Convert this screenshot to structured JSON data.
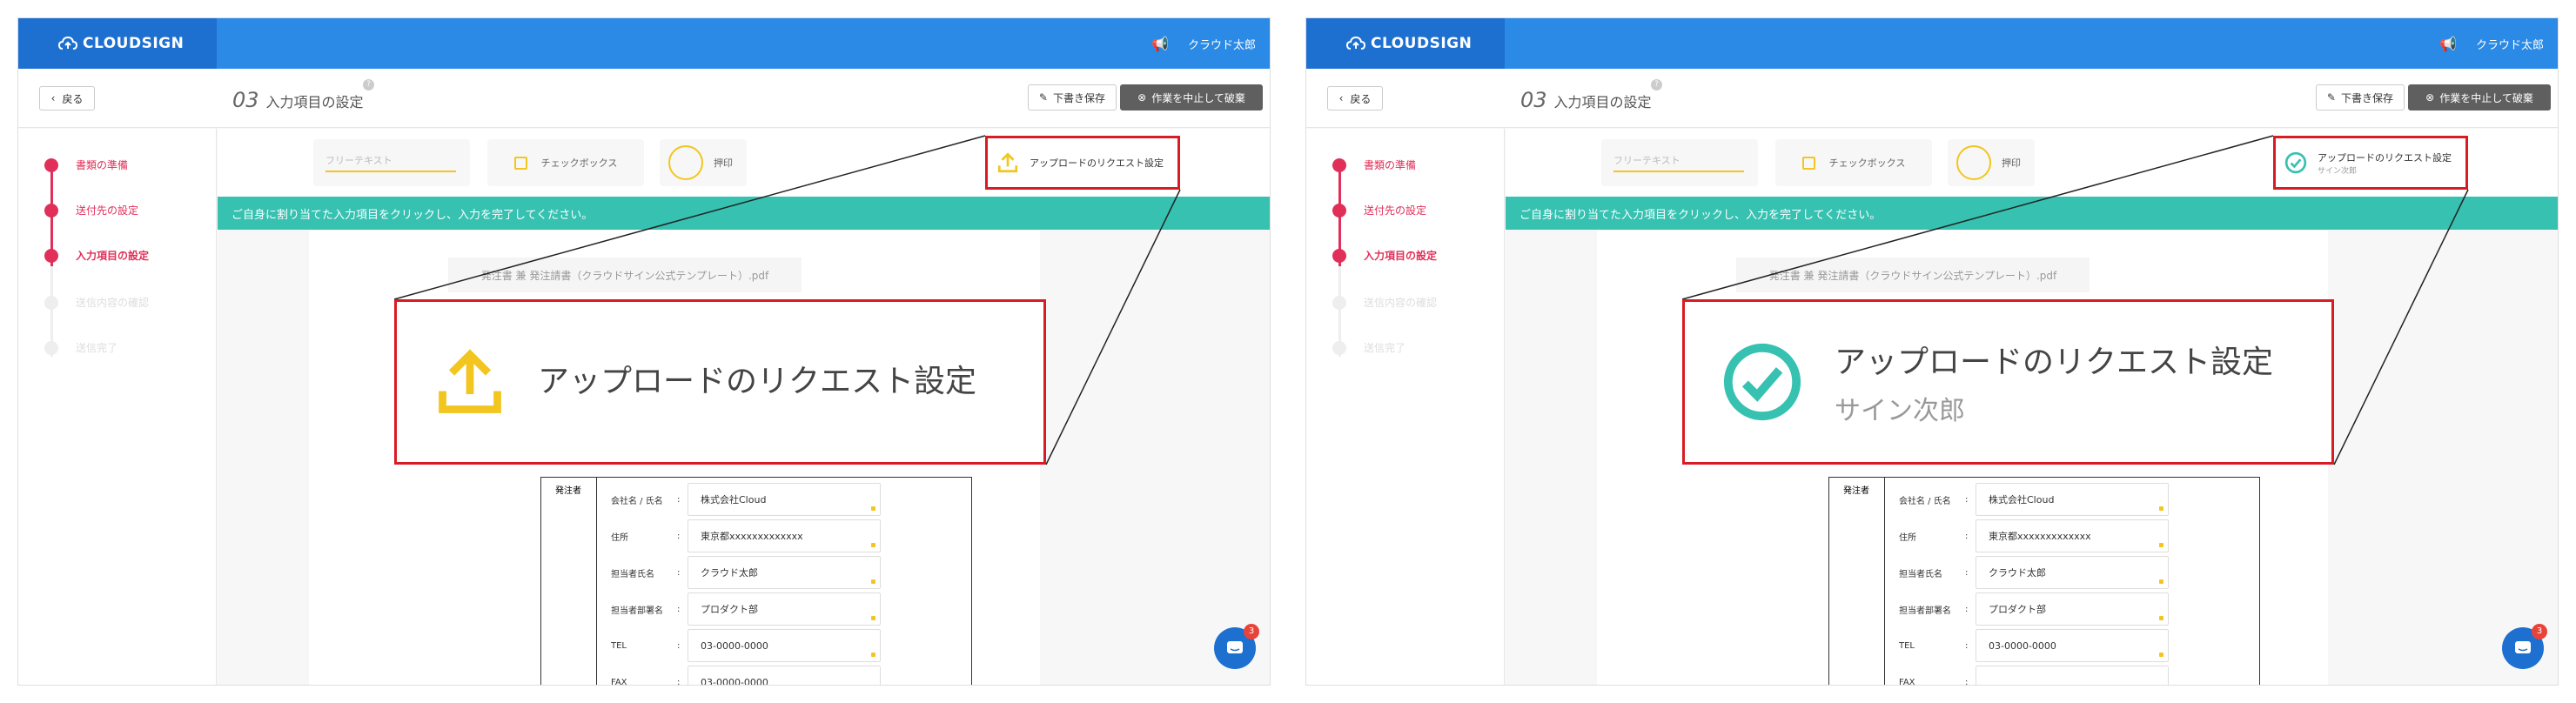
{
  "panels": [
    {
      "logo": "CLOUDSIGN",
      "user": "クラウド太郎",
      "back_label": "戻る",
      "step_num": "03",
      "step_title": "入力項目の設定",
      "help_mark": "?",
      "draft_label": "下書き保存",
      "stop_label": "作業を中止して破棄",
      "steps": [
        {
          "label": "書類の準備"
        },
        {
          "label": "送付先の設定"
        },
        {
          "label": "入力項目の設定"
        },
        {
          "label": "送信内容の確認"
        },
        {
          "label": "送信完了"
        }
      ],
      "fields": {
        "free": "フリーテキスト",
        "checkbox": "チェックボックス",
        "seal": "押印"
      },
      "upload_request": {
        "label": "アップロードのリクエスト設定",
        "assignee": ""
      },
      "banner": "ご自身に割り当てた入力項目をクリックし、入力を完了してください。",
      "file_name": "発注書 兼 発注請書（クラウドサイン公式テンプレート）.pdf",
      "table_header": "発注者",
      "rows": [
        {
          "label": "会社名 / 氏名",
          "value": "株式会社Cloud"
        },
        {
          "label": "住所",
          "value": "東京都xxxxxxxxxxxxx"
        },
        {
          "label": "担当者氏名",
          "value": "クラウド太郎"
        },
        {
          "label": "担当者部署名",
          "value": "プロダクト部"
        },
        {
          "label": "TEL",
          "value": "03-0000-0000"
        },
        {
          "label": "FAX",
          "value": "03-0000-0000"
        }
      ],
      "zoom": {
        "label": "アップロードのリクエスト設定",
        "assignee": "",
        "icon": "upload-icon"
      },
      "chat_badge": "3"
    },
    {
      "logo": "CLOUDSIGN",
      "user": "クラウド太郎",
      "back_label": "戻る",
      "step_num": "03",
      "step_title": "入力項目の設定",
      "help_mark": "?",
      "draft_label": "下書き保存",
      "stop_label": "作業を中止して破棄",
      "steps": [
        {
          "label": "書類の準備"
        },
        {
          "label": "送付先の設定"
        },
        {
          "label": "入力項目の設定"
        },
        {
          "label": "送信内容の確認"
        },
        {
          "label": "送信完了"
        }
      ],
      "fields": {
        "free": "フリーテキスト",
        "checkbox": "チェックボックス",
        "seal": "押印"
      },
      "upload_request": {
        "label": "アップロードのリクエスト設定",
        "assignee": "サイン次郎"
      },
      "banner": "ご自身に割り当てた入力項目をクリックし、入力を完了してください。",
      "file_name": "発注書 兼 発注請書（クラウドサイン公式テンプレート）.pdf",
      "table_header": "発注者",
      "rows": [
        {
          "label": "会社名 / 氏名",
          "value": "株式会社Cloud"
        },
        {
          "label": "住所",
          "value": "東京都xxxxxxxxxxxxx"
        },
        {
          "label": "担当者氏名",
          "value": "クラウド太郎"
        },
        {
          "label": "担当者部署名",
          "value": "プロダクト部"
        },
        {
          "label": "TEL",
          "value": "03-0000-0000"
        },
        {
          "label": "FAX",
          "value": ""
        }
      ],
      "zoom": {
        "label": "アップロードのリクエスト設定",
        "assignee": "サイン次郎",
        "icon": "check-circle-icon"
      },
      "chat_badge": "3"
    }
  ],
  "colors": {
    "brand_blue": "#2a8ae6",
    "accent_red": "#e0305a",
    "teal": "#36c1b1",
    "yellow": "#f2c61f",
    "highlight_red": "#d81c24"
  }
}
